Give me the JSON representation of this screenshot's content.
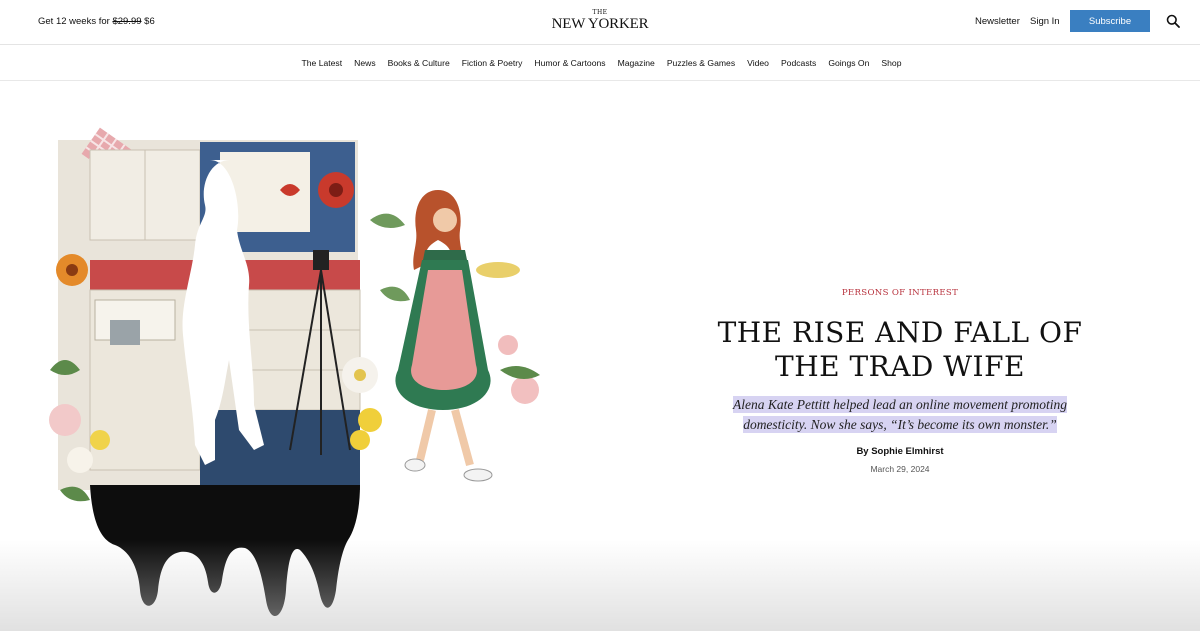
{
  "header": {
    "promo_prefix": "Get 12 weeks for",
    "promo_old_price": "$29.99",
    "promo_new_price": "$6",
    "logo_the": "THE",
    "logo_name": "NEW YORKER",
    "newsletter": "Newsletter",
    "signin": "Sign In",
    "subscribe": "Subscribe",
    "search_icon": "search-icon",
    "subscribe_color": "#3a7fc1"
  },
  "nav": {
    "items": [
      {
        "label": "The Latest"
      },
      {
        "label": "News"
      },
      {
        "label": "Books & Culture"
      },
      {
        "label": "Fiction & Poetry"
      },
      {
        "label": "Humor & Cartoons"
      },
      {
        "label": "Magazine"
      },
      {
        "label": "Puzzles & Games"
      },
      {
        "label": "Video"
      },
      {
        "label": "Podcasts"
      },
      {
        "label": "Goings On"
      },
      {
        "label": "Shop"
      }
    ]
  },
  "article": {
    "rubric": "Persons of Interest",
    "headline_line1": "THE RISE AND FALL OF",
    "headline_line2": "THE TRAD WIFE",
    "dek_line1": "Alena Kate Pettitt helped lead an online movement promoting",
    "dek_line2": "domesticity. Now she says, “It’s become its own monster.”",
    "byline": "By Sophie Elmhirst",
    "date": "March 29, 2024",
    "rubric_color": "#b8343f",
    "dek_highlight_color": "#d7d3f2"
  }
}
